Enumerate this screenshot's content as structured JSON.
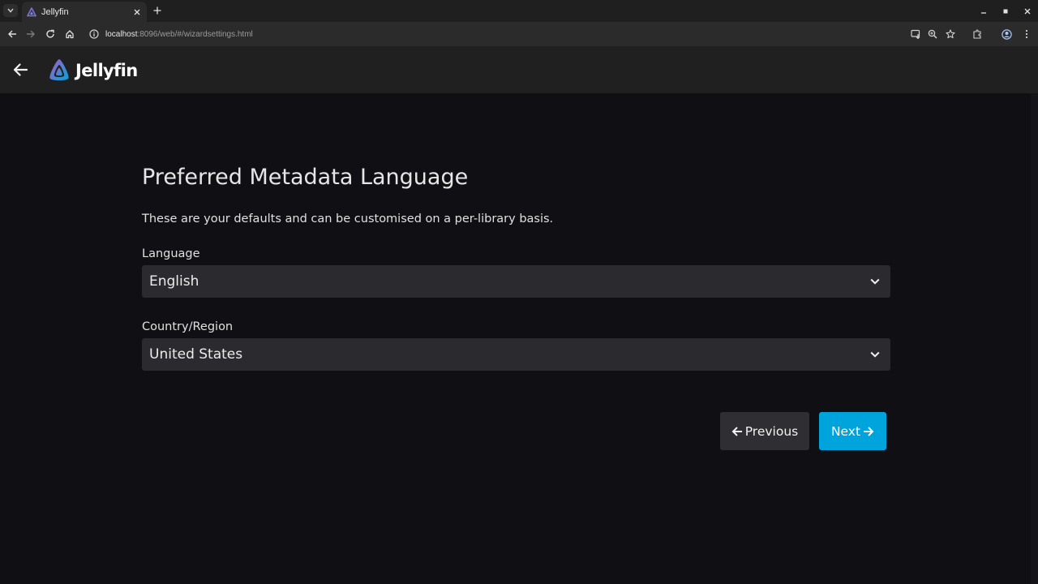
{
  "browser": {
    "tab_title": "Jellyfin",
    "url_host": "localhost",
    "url_rest": ":8096/web/#/wizardsettings.html"
  },
  "app": {
    "logo_text": "Jellyfin"
  },
  "wizard": {
    "title": "Preferred Metadata Language",
    "description": "These are your defaults and can be customised on a per-library basis.",
    "language_label": "Language",
    "language_value": "English",
    "country_label": "Country/Region",
    "country_value": "United States",
    "previous_label": "Previous",
    "next_label": "Next"
  },
  "colors": {
    "accent": "#00a4dc",
    "background": "#101014",
    "header": "#202020",
    "field": "#2b2a2e"
  }
}
